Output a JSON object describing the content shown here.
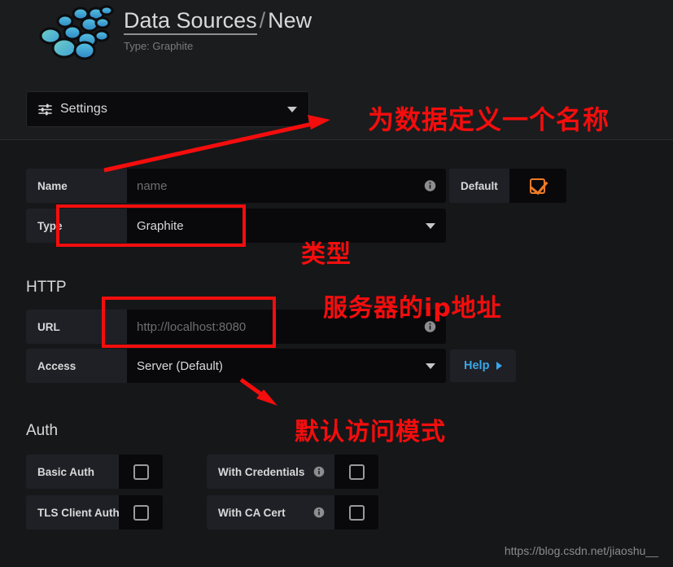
{
  "header": {
    "logo_name": "grafana-logo",
    "breadcrumb_link": "Data Sources",
    "breadcrumb_separator": "/",
    "breadcrumb_current": "New",
    "subtitle": "Type: Graphite"
  },
  "tab_picker": {
    "icon": "sliders-icon",
    "label": "Settings",
    "caret": "chevron-down-icon"
  },
  "form": {
    "name_row": {
      "label": "Name",
      "placeholder": "name",
      "info_icon": "info-icon"
    },
    "default_toggle": {
      "label": "Default",
      "checked": true
    },
    "type_row": {
      "label": "Type",
      "value": "Graphite",
      "caret": "chevron-down-icon"
    }
  },
  "http_section": {
    "title": "HTTP",
    "url_row": {
      "label": "URL",
      "placeholder": "http://localhost:8080",
      "info_icon": "info-icon"
    },
    "access_row": {
      "label": "Access",
      "value": "Server (Default)",
      "caret": "chevron-down-icon"
    },
    "help_button": {
      "label": "Help",
      "caret": "caret-right-icon"
    }
  },
  "auth_section": {
    "title": "Auth",
    "items": [
      {
        "label": "Basic Auth",
        "checked": false,
        "has_info": false
      },
      {
        "label": "With Credentials",
        "checked": false,
        "has_info": true
      },
      {
        "label": "TLS Client Auth",
        "checked": false,
        "has_info": false
      },
      {
        "label": "With CA Cert",
        "checked": false,
        "has_info": true
      }
    ]
  },
  "annotations": {
    "note_name": "为数据定义一个名称",
    "note_type": "类型",
    "note_url": "服务器的ip地址",
    "note_access": "默认访问模式",
    "color": "#f40d0d"
  },
  "watermark": "https://blog.csdn.net/jiaoshu__",
  "colors": {
    "page_bg": "#161719",
    "header_bg": "#1b1c1e",
    "input_bg": "#09090b",
    "label_bg": "#1f2025",
    "accent_orange": "#ed7b27",
    "link_blue": "#3aa6e8",
    "annotation_red": "#f40d0d"
  }
}
